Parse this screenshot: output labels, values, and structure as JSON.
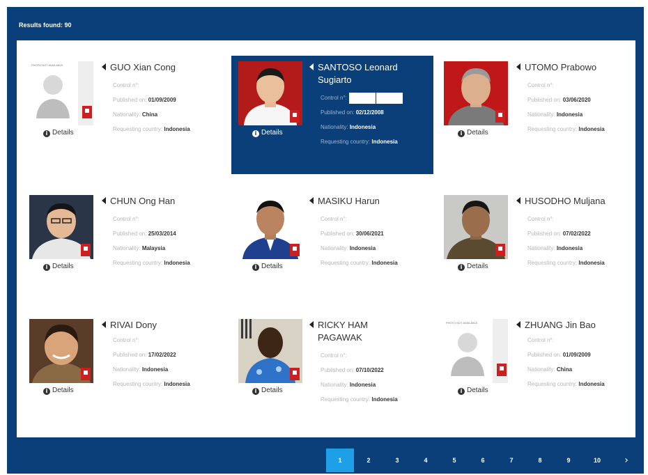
{
  "header": {
    "results_label": "Results found: 90"
  },
  "labels": {
    "control": "Control n°:",
    "published": "Published on:",
    "nationality": "Nationality:",
    "requesting": "Requesting country:",
    "details": "Details",
    "photo_not_available": "PHOTO NOT AVAILABLE"
  },
  "cards": [
    {
      "name": "GUO Xian Cong",
      "published": "01/09/2009",
      "nationality": "China",
      "requesting_country": "Indonesia"
    },
    {
      "name": "SANTOSO Leonard Sugiarto",
      "published": "02/12/2008",
      "nationality": "Indonesia",
      "requesting_country": "Indonesia"
    },
    {
      "name": "UTOMO Prabowo",
      "published": "03/06/2020",
      "nationality": "Indonesia",
      "requesting_country": "Indonesia"
    },
    {
      "name": "CHUN Ong Han",
      "published": "25/03/2014",
      "nationality": "Malaysia",
      "requesting_country": "Indonesia"
    },
    {
      "name": "MASIKU Harun",
      "published": "30/06/2021",
      "nationality": "Indonesia",
      "requesting_country": "Indonesia"
    },
    {
      "name": "HUSODHO Muljana",
      "published": "07/02/2022",
      "nationality": "Indonesia",
      "requesting_country": "Indonesia"
    },
    {
      "name": "RIVAI Dony",
      "published": "17/02/2022",
      "nationality": "Indonesia",
      "requesting_country": "Indonesia"
    },
    {
      "name": "RICKY HAM PAGAWAK",
      "published": "07/10/2022",
      "nationality": "Indonesia",
      "requesting_country": "Indonesia"
    },
    {
      "name": "ZHUANG Jin Bao",
      "published": "01/09/2009",
      "nationality": "China",
      "requesting_country": "Indonesia"
    }
  ],
  "pagination": {
    "pages": [
      "1",
      "2",
      "3",
      "4",
      "5",
      "6",
      "7",
      "8",
      "9",
      "10"
    ],
    "active_page": "1"
  },
  "colors": {
    "brand": "#0a3f79",
    "active_page": "#1ea0e6",
    "notice_red": "#cc1f1f"
  }
}
